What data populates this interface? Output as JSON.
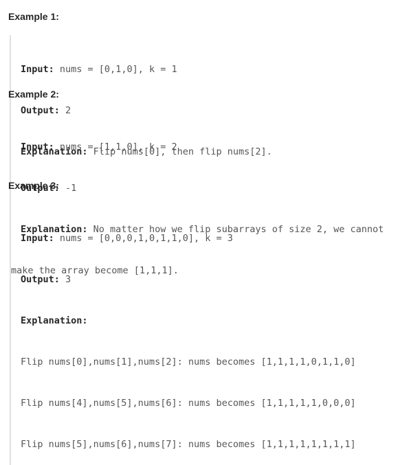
{
  "examples": [
    {
      "heading": "Example 1:",
      "input_label": "Input:",
      "input_value": " nums = [0,1,0], k = 1",
      "output_label": "Output:",
      "output_value": " 2",
      "explanation_label": "Explanation:",
      "explanation_value": " Flip nums[0], then flip nums[2]."
    },
    {
      "heading": "Example 2:",
      "input_label": "Input:",
      "input_value": " nums = [1,1,0], k = 2",
      "output_label": "Output:",
      "output_value": " -1",
      "explanation_label": "Explanation:",
      "explanation_value": " No matter how we flip subarrays of size 2, we cannot",
      "explanation_cont": "make the array become [1,1,1]."
    },
    {
      "heading": "Example 3:",
      "input_label": "Input:",
      "input_value": " nums = [0,0,0,1,0,1,1,0], k = 3",
      "output_label": "Output:",
      "output_value": " 3",
      "explanation_label": "Explanation:",
      "explanation_lines": [
        "Flip nums[0],nums[1],nums[2]: nums becomes [1,1,1,1,0,1,1,0]",
        "Flip nums[4],nums[5],nums[6]: nums becomes [1,1,1,1,1,0,0,0]",
        "Flip nums[5],nums[6],nums[7]: nums becomes [1,1,1,1,1,1,1,1]"
      ]
    }
  ]
}
